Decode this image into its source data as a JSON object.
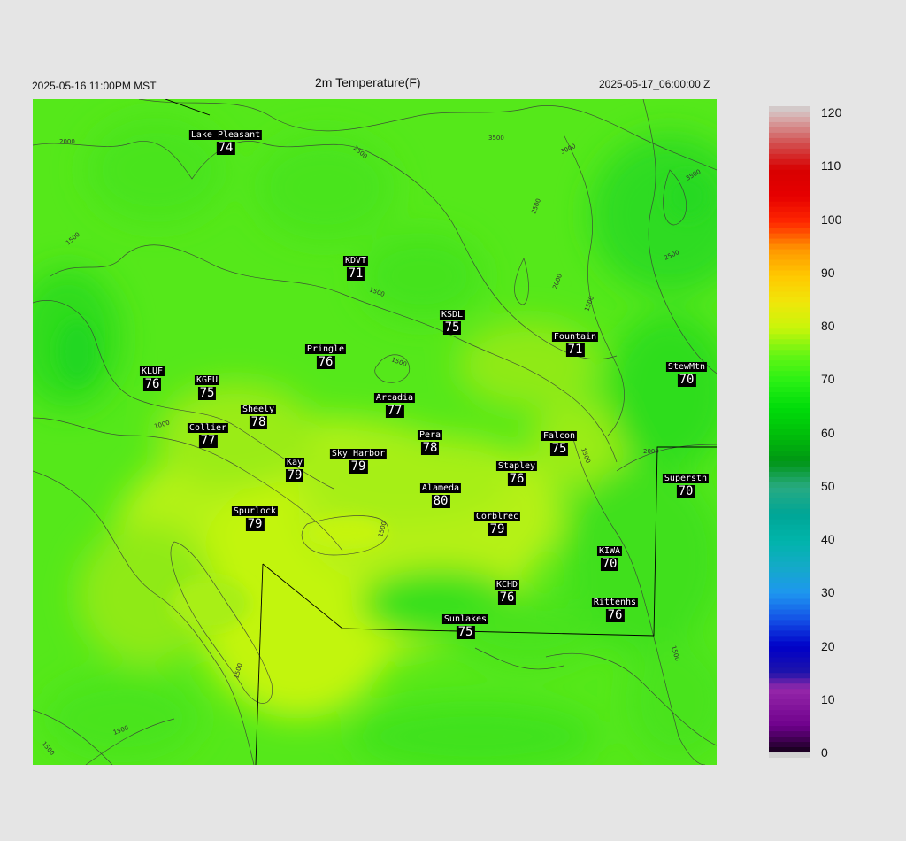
{
  "header": {
    "left": "2025-05-16 11:00PM MST",
    "title": "2m Temperature(F)",
    "right": "2025-05-17_06:00:00 Z"
  },
  "map": {
    "base_color": "#55e81a",
    "contour_labels": [
      "2000",
      "2500",
      "3500",
      "3000",
      "3500",
      "2500",
      "2000",
      "2500",
      "1500",
      "1500",
      "1500",
      "2000",
      "1500",
      "1000",
      "1500",
      "1500",
      "1500",
      "1500",
      "1500",
      "1500"
    ]
  },
  "stations": [
    {
      "name": "Lake Pleasant",
      "value": "74"
    },
    {
      "name": "KDVT",
      "value": "71"
    },
    {
      "name": "KSDL",
      "value": "75"
    },
    {
      "name": "Fountain",
      "value": "71"
    },
    {
      "name": "Pringle",
      "value": "76"
    },
    {
      "name": "KLUF",
      "value": "76"
    },
    {
      "name": "KGEU",
      "value": "75"
    },
    {
      "name": "StewMtn",
      "value": "70"
    },
    {
      "name": "Arcadia",
      "value": "77"
    },
    {
      "name": "Sheely",
      "value": "78"
    },
    {
      "name": "Collier",
      "value": "77"
    },
    {
      "name": "Pera",
      "value": "78"
    },
    {
      "name": "Falcon",
      "value": "75"
    },
    {
      "name": "Sky Harbor",
      "value": "79"
    },
    {
      "name": "Kay",
      "value": "79"
    },
    {
      "name": "Stapley",
      "value": "76"
    },
    {
      "name": "Superstn",
      "value": "70"
    },
    {
      "name": "Alameda",
      "value": "80"
    },
    {
      "name": "Spurlock",
      "value": "79"
    },
    {
      "name": "Corblrec",
      "value": "79"
    },
    {
      "name": "KIWA",
      "value": "70"
    },
    {
      "name": "KCHD",
      "value": "76"
    },
    {
      "name": "Rittenhs",
      "value": "76"
    },
    {
      "name": "Sunlakes",
      "value": "75"
    }
  ],
  "colorbar": {
    "labels": [
      "120",
      "110",
      "100",
      "90",
      "80",
      "70",
      "60",
      "50",
      "40",
      "30",
      "20",
      "10",
      "0"
    ],
    "min": 0,
    "max": 120
  }
}
